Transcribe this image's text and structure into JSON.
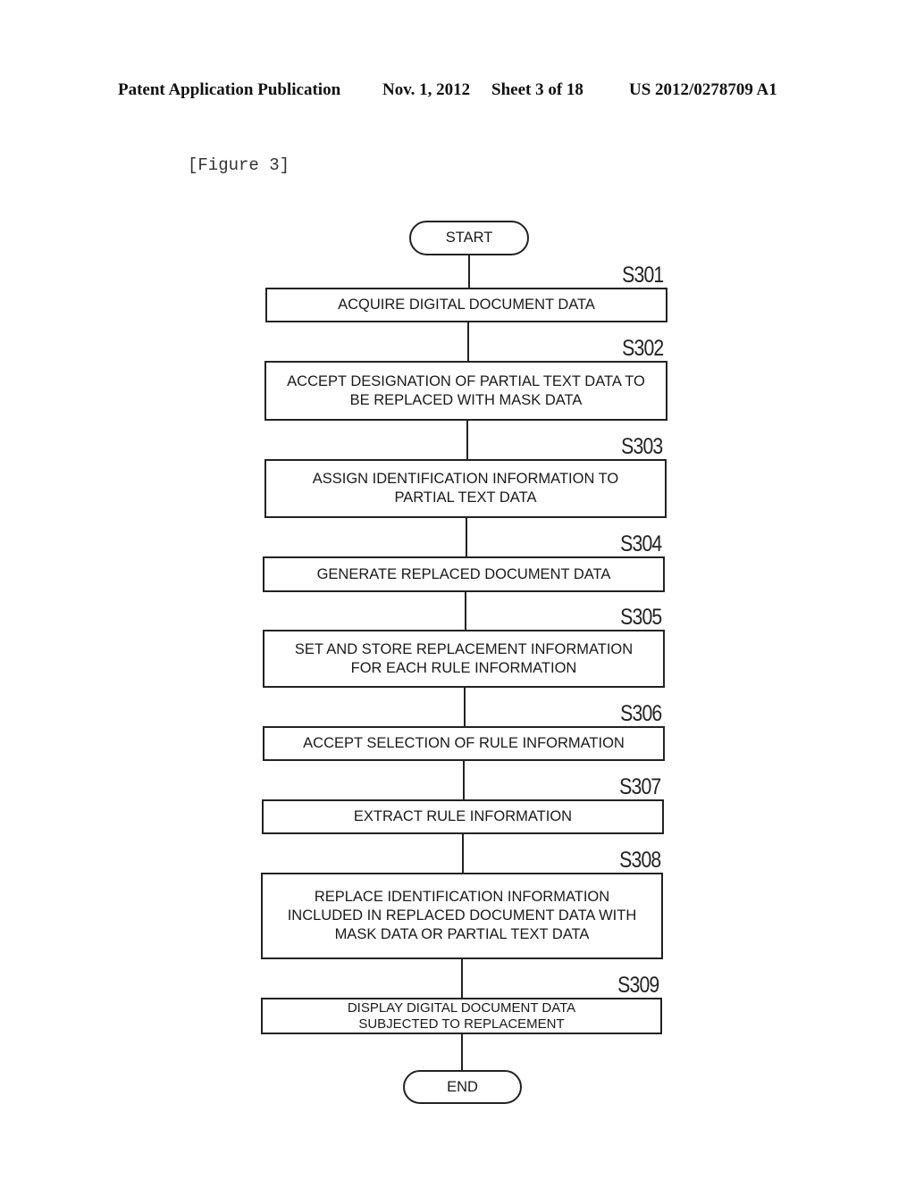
{
  "header": {
    "publication": "Patent Application Publication",
    "date": "Nov. 1, 2012",
    "sheet": "Sheet 3 of 18",
    "number": "US 2012/0278709 A1"
  },
  "figure_label": "[Figure 3]",
  "flowchart": {
    "start": "START",
    "end": "END",
    "steps": [
      {
        "id": "S301",
        "text": "ACQUIRE DIGITAL DOCUMENT DATA"
      },
      {
        "id": "S302",
        "text": "ACCEPT DESIGNATION OF PARTIAL TEXT DATA TO\nBE REPLACED WITH MASK DATA"
      },
      {
        "id": "S303",
        "text": "ASSIGN IDENTIFICATION INFORMATION TO\nPARTIAL TEXT DATA"
      },
      {
        "id": "S304",
        "text": "GENERATE REPLACED DOCUMENT DATA"
      },
      {
        "id": "S305",
        "text": "SET AND STORE REPLACEMENT INFORMATION\nFOR EACH RULE INFORMATION"
      },
      {
        "id": "S306",
        "text": "ACCEPT SELECTION OF RULE INFORMATION"
      },
      {
        "id": "S307",
        "text": "EXTRACT RULE INFORMATION"
      },
      {
        "id": "S308",
        "text": "REPLACE IDENTIFICATION INFORMATION\nINCLUDED IN REPLACED DOCUMENT DATA WITH\nMASK DATA OR PARTIAL TEXT DATA"
      },
      {
        "id": "S309",
        "text": "DISPLAY DIGITAL DOCUMENT DATA\nSUBJECTED TO REPLACEMENT"
      }
    ]
  }
}
